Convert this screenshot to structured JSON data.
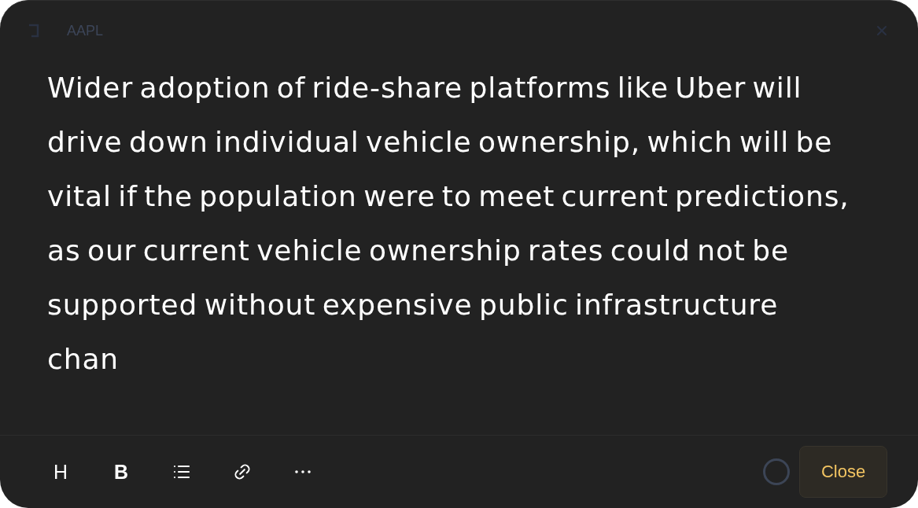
{
  "header": {
    "title": "AAPL"
  },
  "editor": {
    "text": "Wider adoption of ride-share platforms like Uber will drive down individual vehicle ownership, which will be vital if the population were to meet current predictions, as our current vehicle ownership rates could not be supported without expensive public infrastructure chan"
  },
  "toolbar": {
    "tools": [
      {
        "kind": "glyph",
        "label": "H"
      },
      {
        "kind": "glyph",
        "label": "B"
      },
      {
        "kind": "list"
      },
      {
        "kind": "link"
      },
      {
        "kind": "more"
      }
    ],
    "close_button": {
      "label": "Close"
    }
  }
}
